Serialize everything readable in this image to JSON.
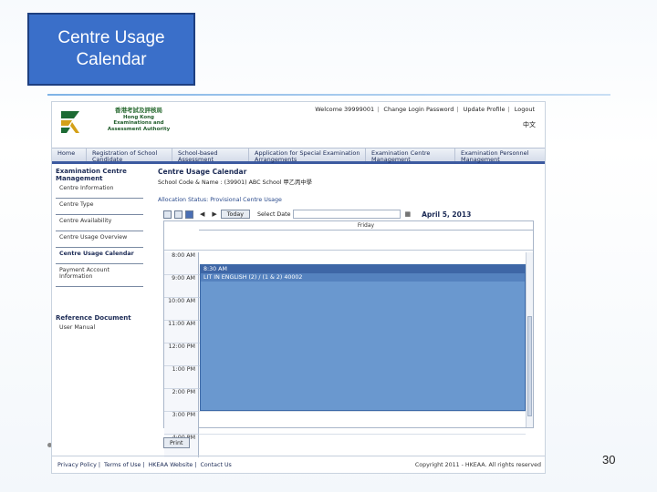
{
  "slide": {
    "title_line1": "Centre Usage",
    "title_line2": "Calendar",
    "page_number": "30"
  },
  "header": {
    "org_cn": "香港考試及評核局",
    "org_en_line1": "Hong Kong",
    "org_en_line2": "Examinations and",
    "org_en_line3": "Assessment Authority",
    "links": [
      "Welcome 39999001",
      "Change Login Password",
      "Update Profile",
      "Logout"
    ],
    "language": "中文"
  },
  "nav": {
    "items": [
      "Home",
      "Registration of School Candidate",
      "School-based Assessment",
      "Application for Special Examination Arrangements",
      "Examination Centre Management",
      "Examination Personnel Management"
    ]
  },
  "sidebar": {
    "section_title": "Examination Centre Management",
    "items": [
      "Centre Information",
      "Centre Type",
      "Centre Availability",
      "Centre Usage Overview",
      "Centre Usage Calendar",
      "Payment Account Information"
    ],
    "active_index": 4,
    "reference_title": "Reference Document",
    "reference_items": [
      "User Manual"
    ]
  },
  "main": {
    "title": "Centre Usage Calendar",
    "school_label": "School Code & Name :",
    "school_code": "(39901)",
    "school_name": "ABC School",
    "school_name_cn": "甲乙丙中學",
    "status": "Allocation Status: Provisional Centre Usage"
  },
  "toolbar": {
    "today_label": "Today",
    "select_date_label": "Select Date",
    "select_date_value": "",
    "current_date": "April 5, 2013"
  },
  "calendar": {
    "day_label": "Friday",
    "times": [
      "8:00 AM",
      "9:00 AM",
      "10:00 AM",
      "11:00 AM",
      "12:00 PM",
      "1:00 PM",
      "2:00 PM",
      "3:00 PM",
      "4:00 PM"
    ],
    "event": {
      "time": "8:30 AM",
      "title": "LIT IN ENGLISH (2) / (1 & 2) 40002"
    }
  },
  "print_label": "Print",
  "footer": {
    "links": [
      "Privacy Policy",
      "Terms of Use",
      "HKEAA Website",
      "Contact Us"
    ],
    "copyright": "Copyright 2011 - HKEAA. All rights reserved"
  },
  "colors": {
    "title_box": "#3a6fc9",
    "event_fill": "#6a98cf",
    "nav_underline": "#3c5aa0"
  }
}
